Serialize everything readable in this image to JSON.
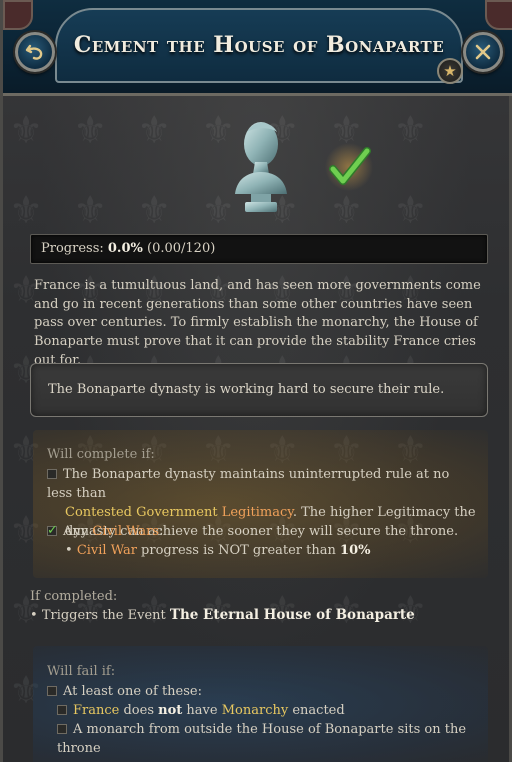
{
  "header": {
    "title": "Cement the House of Bonaparte",
    "back_icon": "undo-arrow-icon",
    "close_icon": "close-x-icon",
    "star_icon": "star-icon"
  },
  "progress": {
    "label": "Progress:",
    "percent": "0.0%",
    "detail": "(0.00/120)",
    "value": 0.0
  },
  "description": "France is a tumultuous land, and has seen more governments come and go in recent generations than some other countries have seen pass over centuries. To firmly establish the monarchy, the House of Bonaparte must prove that it can provide the stability France cries out for.",
  "status_text": "The Bonaparte dynasty is working hard to secure their rule.",
  "will_complete": {
    "heading": "Will complete if:",
    "cond1": {
      "checked": false,
      "text_a": "The Bonaparte dynasty maintains uninterrupted rule at no less than",
      "kw1": "Contested Government",
      "kw2": "Legitimacy",
      "text_b": ". The higher Legitimacy the dynasty can achieve the sooner they will secure the throne."
    },
    "cond2": {
      "checked": true,
      "prefix": "Any",
      "kw": "Civil Wars",
      "suffix": ":"
    },
    "cond3": {
      "bullet": "•",
      "kw": "Civil War",
      "text": "progress is NOT greater than",
      "value": "10%"
    }
  },
  "if_completed": {
    "heading": "If completed:",
    "bullet": "•",
    "text": "Triggers the Event",
    "event": "The Eternal House of Bonaparte"
  },
  "will_fail": {
    "heading": "Will fail if:",
    "cond1": "At least one of these:",
    "cond2": {
      "kw1": "France",
      "t1": "does",
      "not": "not",
      "t2": "have",
      "kw2": "Monarchy",
      "t3": "enacted"
    },
    "cond3": "A monarch from outside the House of Bonaparte sits on the throne"
  },
  "colors": {
    "accent_orange": "#f0a15a",
    "accent_yellow": "#e8c860",
    "check_green": "#6fcf50"
  }
}
